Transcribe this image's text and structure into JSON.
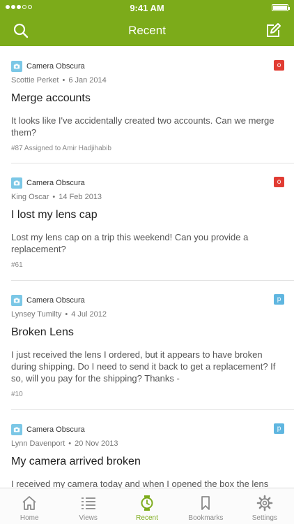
{
  "status_bar": {
    "time": "9:41 AM"
  },
  "header": {
    "title": "Recent",
    "search_icon": "search-icon",
    "compose_icon": "compose-icon"
  },
  "colors": {
    "brand": "#7cab1a",
    "badge_open": "#e13c33",
    "badge_pending": "#5fb6e0",
    "brand_icon": "#7bc7e6"
  },
  "tickets": [
    {
      "brand": "Camera Obscura",
      "author": "Scottie Perket",
      "date": "6 Jan 2014",
      "badge": "o",
      "title": "Merge accounts",
      "body": "It looks like I've accidentally created two accounts. Can we merge them?",
      "footer": "#87 Assigned to Amir Hadjihabib"
    },
    {
      "brand": "Camera Obscura",
      "author": "King Oscar",
      "date": "14 Feb 2013",
      "badge": "o",
      "title": "I lost my lens cap",
      "body": "Lost my lens cap on a trip this weekend! Can you provide a replacement?",
      "footer": "#61"
    },
    {
      "brand": "Camera Obscura",
      "author": "Lynsey Tumilty",
      "date": "4 Jul 2012",
      "badge": "p",
      "title": "Broken Lens",
      "body": "I just received the lens I ordered, but it appears to have broken during shipping.  Do I need to send it back to get a replacement? If so, will you pay for the shipping?  Thanks -",
      "footer": "#10"
    },
    {
      "brand": "Camera Obscura",
      "author": "Lynn Davenport",
      "date": "20 Nov 2013",
      "badge": "p",
      "title": "My camera arrived broken",
      "body": "I received my camera today and when I opened the box the lens was cracked.",
      "footer": ""
    }
  ],
  "tabs": [
    {
      "label": "Home",
      "icon": "home-icon",
      "active": false
    },
    {
      "label": "Views",
      "icon": "list-icon",
      "active": false
    },
    {
      "label": "Recent",
      "icon": "clock-icon",
      "active": true
    },
    {
      "label": "Bookmarks",
      "icon": "bookmark-icon",
      "active": false
    },
    {
      "label": "Settings",
      "icon": "gear-icon",
      "active": false
    }
  ]
}
